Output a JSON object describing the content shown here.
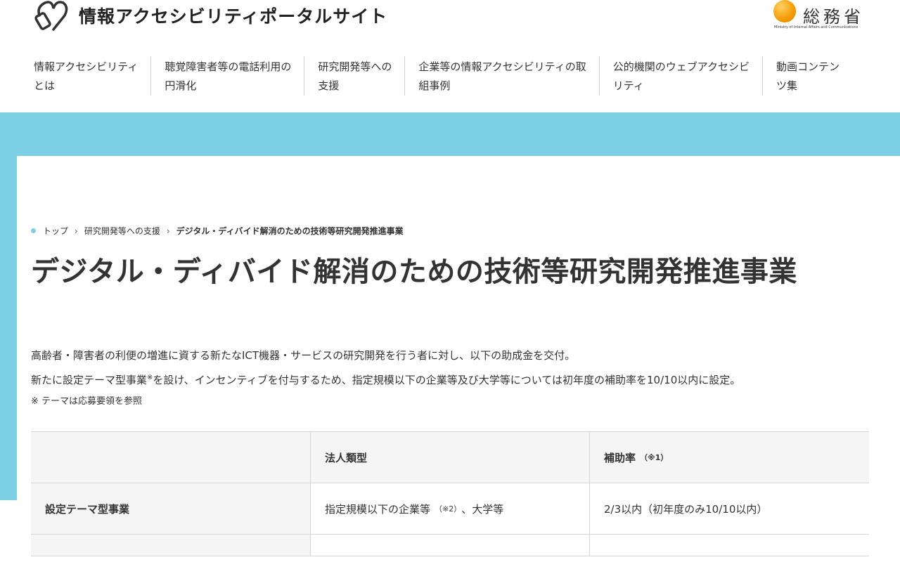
{
  "header": {
    "site_title": "情報アクセシビリティポータルサイト",
    "ministry_jp": "総務省",
    "ministry_en": "Ministry of Internal Affairs and Communications"
  },
  "nav": [
    {
      "line1": "情報アクセシビリティ",
      "line2": "とは"
    },
    {
      "line1": "聴覚障害者等の電話利用の",
      "line2": "円滑化"
    },
    {
      "line1": "研究開発等への",
      "line2": "支援"
    },
    {
      "line1": "企業等の情報アクセシビリティの取",
      "line2": "組事例"
    },
    {
      "line1": "公的機関のウェブアクセシビ",
      "line2": "リティ"
    },
    {
      "line1": "動画コンテン",
      "line2": "ツ集"
    }
  ],
  "breadcrumb": {
    "home": "トップ",
    "parent": "研究開発等への支援",
    "current": "デジタル・ディバイド解消のための技術等研究開発推進事業",
    "separator": "›"
  },
  "page_title": "デジタル・ディバイド解消のための技術等研究開発推進事業",
  "body": {
    "line1": "高齢者・障害者の利便の増進に資する新たなICT機器・サービスの研究開発を行う者に対し、以下の助成金を交付。",
    "line2_a": "新たに設定テーマ型事業",
    "line2_sup": "※",
    "line2_b": "を設け、インセンティブを付与するため、指定規模以下の企業等及び大学等については初年度の補助率を10/10以内に設定。",
    "note": "※ テーマは応募要領を参照"
  },
  "table": {
    "headers": [
      "",
      "法人類型",
      "補助率"
    ],
    "header_sup": "（※1）",
    "rows": [
      {
        "type": "設定テーマ型事業",
        "entity": "指定規模以下の企業等",
        "entity_sup": "（※2）",
        "entity_tail": "、大学等",
        "rate": "2/3以内（初年度のみ10/10以内）"
      }
    ]
  },
  "colors": {
    "accent_blue": "#7dcfe4",
    "ministry_orange": "#f59a00"
  }
}
